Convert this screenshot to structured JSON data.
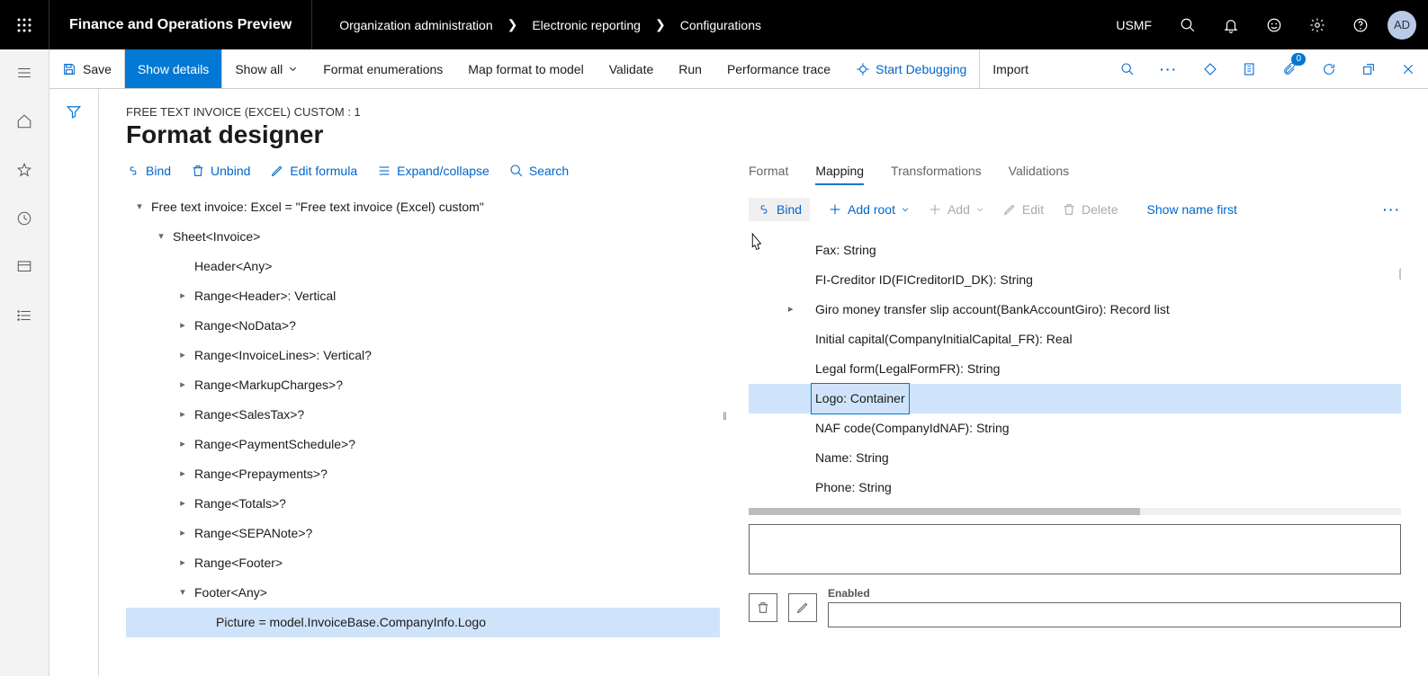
{
  "header": {
    "appTitle": "Finance and Operations Preview",
    "breadcrumbs": [
      "Organization administration",
      "Electronic reporting",
      "Configurations"
    ],
    "entity": "USMF",
    "avatar": "AD"
  },
  "actions": {
    "save": "Save",
    "showDetails": "Show details",
    "showAll": "Show all",
    "formatEnum": "Format enumerations",
    "mapModel": "Map format to model",
    "validate": "Validate",
    "run": "Run",
    "perfTrace": "Performance trace",
    "startDebug": "Start Debugging",
    "import": "Import",
    "attachCount": "0"
  },
  "page": {
    "path": "FREE TEXT INVOICE (EXCEL) CUSTOM : 1",
    "title": "Format designer"
  },
  "leftTools": {
    "bind": "Bind",
    "unbind": "Unbind",
    "editFormula": "Edit formula",
    "expand": "Expand/collapse",
    "search": "Search"
  },
  "tree": [
    {
      "depth": 0,
      "caret": "down",
      "label": "Free text invoice: Excel = \"Free text invoice (Excel) custom\""
    },
    {
      "depth": 1,
      "caret": "down",
      "label": "Sheet<Invoice>"
    },
    {
      "depth": 2,
      "caret": "",
      "label": "Header<Any>"
    },
    {
      "depth": 2,
      "caret": "right",
      "label": "Range<Header>: Vertical"
    },
    {
      "depth": 2,
      "caret": "right",
      "label": "Range<NoData>?"
    },
    {
      "depth": 2,
      "caret": "right",
      "label": "Range<InvoiceLines>: Vertical?"
    },
    {
      "depth": 2,
      "caret": "right",
      "label": "Range<MarkupCharges>?"
    },
    {
      "depth": 2,
      "caret": "right",
      "label": "Range<SalesTax>?"
    },
    {
      "depth": 2,
      "caret": "right",
      "label": "Range<PaymentSchedule>?"
    },
    {
      "depth": 2,
      "caret": "right",
      "label": "Range<Prepayments>?"
    },
    {
      "depth": 2,
      "caret": "right",
      "label": "Range<Totals>?"
    },
    {
      "depth": 2,
      "caret": "right",
      "label": "Range<SEPANote>?"
    },
    {
      "depth": 2,
      "caret": "right",
      "label": "Range<Footer>"
    },
    {
      "depth": 2,
      "caret": "down",
      "label": "Footer<Any>"
    },
    {
      "depth": 3,
      "caret": "",
      "label": "Picture = model.InvoiceBase.CompanyInfo.Logo",
      "selected": true
    }
  ],
  "tabs": {
    "format": "Format",
    "mapping": "Mapping",
    "transformations": "Transformations",
    "validations": "Validations"
  },
  "mappingTools": {
    "bind": "Bind",
    "addRoot": "Add root",
    "add": "Add",
    "edit": "Edit",
    "delete": "Delete",
    "showNameFirst": "Show name first"
  },
  "mappingList": [
    {
      "caret": "",
      "label": "Fax: String"
    },
    {
      "caret": "",
      "label": "FI-Creditor ID(FICreditorID_DK): String"
    },
    {
      "caret": "right",
      "label": "Giro money transfer slip account(BankAccountGiro): Record list"
    },
    {
      "caret": "",
      "label": "Initial capital(CompanyInitialCapital_FR): Real"
    },
    {
      "caret": "",
      "label": "Legal form(LegalFormFR): String"
    },
    {
      "caret": "",
      "label": "Logo: Container",
      "selected": true
    },
    {
      "caret": "",
      "label": "NAF code(CompanyIdNAF): String"
    },
    {
      "caret": "",
      "label": "Name: String"
    },
    {
      "caret": "",
      "label": "Phone: String"
    }
  ],
  "fields": {
    "enabledLabel": "Enabled"
  }
}
